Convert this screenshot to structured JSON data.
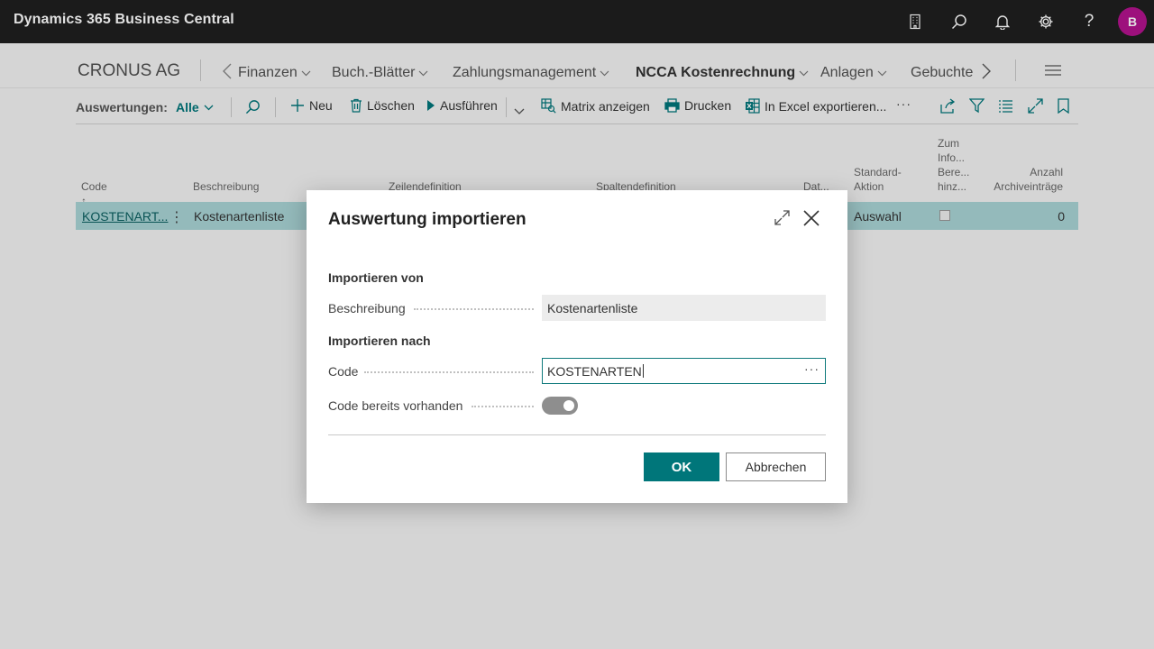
{
  "app": {
    "title": "Dynamics 365 Business Central",
    "avatar_initial": "B",
    "avatar_color": "#b3138e"
  },
  "topbar_icons": [
    "building-icon",
    "search-icon",
    "bell-icon",
    "gear-icon",
    "help-icon"
  ],
  "nav": {
    "company": "CRONUS AG",
    "items": [
      {
        "label": "Finanzen"
      },
      {
        "label": "Buch.-Blätter"
      },
      {
        "label": "Zahlungsmanagement"
      },
      {
        "label": "NCCA Kostenrechnung",
        "active": true
      },
      {
        "label": "Anlagen"
      },
      {
        "label": "Gebuchte I"
      }
    ]
  },
  "actionbar": {
    "label": "Auswertungen:",
    "filter_value": "Alle",
    "new": "Neu",
    "delete": "Löschen",
    "run": "Ausführen",
    "matrix": "Matrix anzeigen",
    "print": "Drucken",
    "excel": "In Excel exportieren...",
    "more": "···"
  },
  "grid": {
    "headers": {
      "code": "Code ↑",
      "beschreibung": "Beschreibung",
      "zeilendefinition": "Zeilendefinition",
      "spaltendefinition": "Spaltendefinition",
      "dat": "Dat...",
      "standard_1": "Standard-",
      "standard_2": "Aktion",
      "info_1": "Zum",
      "info_2": "Info...",
      "info_3": "Bere...",
      "info_4": "hinz...",
      "anzahl_1": "Anzahl",
      "anzahl_2": "Archiveinträge"
    },
    "rows": [
      {
        "code": "KOSTENART...",
        "beschreibung": "Kostenartenliste",
        "standard_aktion": "Auswahl",
        "anzahl": "0"
      }
    ]
  },
  "dialog": {
    "title": "Auswertung importieren",
    "section_from": "Importieren von",
    "beschreibung_label": "Beschreibung",
    "beschreibung_value": "Kostenartenliste",
    "section_to": "Importieren nach",
    "code_label": "Code",
    "code_value": "KOSTENARTEN",
    "code_more": "···",
    "exists_label": "Code bereits vorhanden",
    "exists_value": true,
    "ok": "OK",
    "cancel": "Abbrechen"
  },
  "colors": {
    "accent": "#00767a",
    "selected_row": "#a9d4d5",
    "topbar": "#1f1f1f"
  }
}
